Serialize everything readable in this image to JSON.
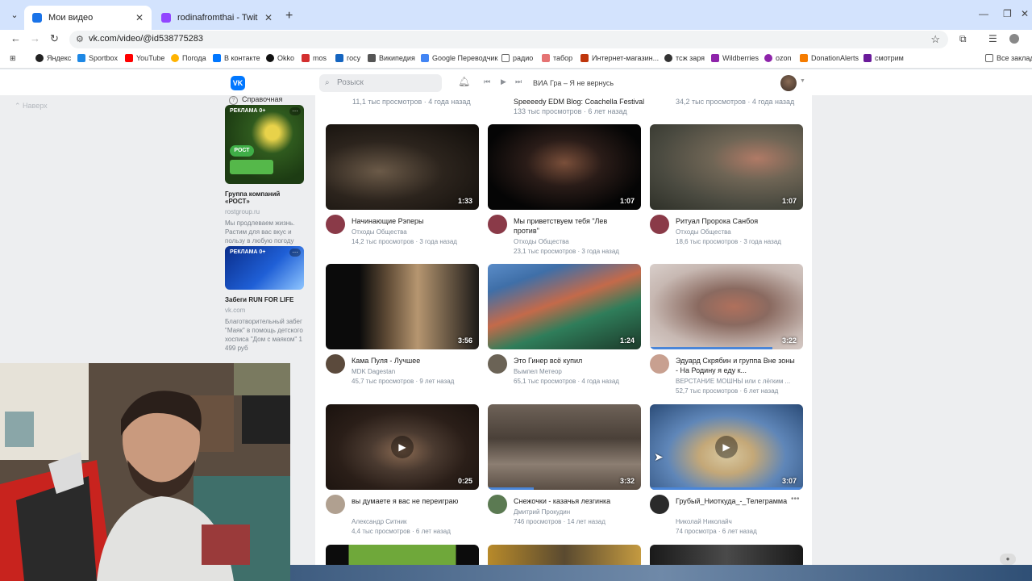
{
  "browser": {
    "tabs": [
      {
        "title": "Мои видео",
        "favicon_color": "#1a73e8",
        "active": true
      },
      {
        "title": "rodinafromthai - Twitch",
        "favicon_color": "#9146ff",
        "active": false
      }
    ],
    "url": "vk.com/video/@id538775283",
    "bookmarks": [
      {
        "label": "Яндекс",
        "color": "#222222"
      },
      {
        "label": "Sportbox",
        "color": "#1e88e5"
      },
      {
        "label": "YouTube",
        "color": "#ff0000"
      },
      {
        "label": "Погода",
        "color": "#ffb300"
      },
      {
        "label": "В контакте",
        "color": "#0077ff"
      },
      {
        "label": "Okko",
        "color": "#111111"
      },
      {
        "label": "mos",
        "color": "#d32f2f"
      },
      {
        "label": "госу",
        "color": "#1565c0"
      },
      {
        "label": "Википедия",
        "color": "#555555"
      },
      {
        "label": "Google Переводчик",
        "color": "#4285f4"
      },
      {
        "label": "радио",
        "color": "#666666"
      },
      {
        "label": "табор",
        "color": "#e57373"
      },
      {
        "label": "Интернет-магазин...",
        "color": "#bf360c"
      },
      {
        "label": "тсж заря",
        "color": "#333333"
      },
      {
        "label": "Wildberries",
        "color": "#8e24aa"
      },
      {
        "label": "ozon",
        "color": "#8e24aa"
      },
      {
        "label": "DonationAlerts",
        "color": "#f57c00"
      },
      {
        "label": "смотрим",
        "color": "#6a1b9a"
      },
      {
        "label": "Все заклад",
        "color": "#666666"
      }
    ]
  },
  "vk": {
    "search_placeholder": "Розыск",
    "now_playing": "ВИА Гра – Я не вернусь",
    "up_label": "Наверх",
    "help_label": "Справочная",
    "ads": [
      {
        "badge": "РЕКЛАМА 0+",
        "title": "Группа компаний «РОСТ»",
        "domain": "rostgroup.ru",
        "text": "Мы продлеваем жизнь. Растим для вас вкус и пользу в любую погоду"
      },
      {
        "badge": "РЕКЛАМА 0+",
        "title": "Забеги RUN FOR LIFE",
        "domain": "vk.com",
        "text": "Благотворительный забег \"Маяк\" в помощь детского хосписа \"Дом с маяком\" 1 499 руб"
      }
    ],
    "top_partial": [
      "11,1 тыс просмотров · 4 года назад",
      "Speeeedy EDM Blog: Coachella Festival",
      "133 тыс просмотров · 6 лет назад",
      "34,2 тыс просмотров · 4 года назад"
    ],
    "videos": [
      {
        "title": "Начинающие Рэперы",
        "channel": "Отходы Общества",
        "stats": "14,2 тыс просмотров · 3 года назад",
        "duration": "1:33",
        "progress": 0
      },
      {
        "title": "Мы приветствуем тебя \"Лев против\"",
        "channel": "Отходы Общества",
        "stats": "23,1 тыс просмотров · 3 года назад",
        "duration": "1:07",
        "progress": 0
      },
      {
        "title": "Ритуал Пророка Санбоя",
        "channel": "Отходы Общества",
        "stats": "18,6 тыс просмотров · 3 года назад",
        "duration": "1:07",
        "progress": 0
      },
      {
        "title": "Кама Пуля - Лучшее",
        "channel": "MDK Dagestan",
        "stats": "45,7 тыс просмотров · 9 лет назад",
        "duration": "3:56",
        "progress": 0
      },
      {
        "title": "Это Гинер всё купил",
        "channel": "Вымпел Метеор",
        "stats": "65,1 тыс просмотров · 4 года назад",
        "duration": "1:24",
        "progress": 0
      },
      {
        "title": "Эдуард Скрябин и группа Вне зоны - На Родину я еду к...",
        "channel": "ВЕРСТАНИЕ МОШНЫ или с лёгким ...",
        "stats": "52,7 тыс просмотров · 6 лет назад",
        "duration": "3:22",
        "progress": 0.8
      },
      {
        "title": "вы думаете я вас не переиграю",
        "channel": "Александр Ситник",
        "stats": "4,4 тыс просмотров · 6 лет назад",
        "duration": "0:25",
        "progress": 0
      },
      {
        "title": "Снежочки - казачья лезгинка",
        "channel": "Дмитрий Прокудин",
        "stats": "746 просмотров · 14 лет назад",
        "duration": "3:32",
        "progress": 0.3
      },
      {
        "title": "Грубый_Ниоткуда_-_Телеграмма",
        "channel": "Николай Николайч",
        "stats": "74 просмотра · 6 лет назад",
        "duration": "3:07",
        "progress": 1
      }
    ]
  }
}
